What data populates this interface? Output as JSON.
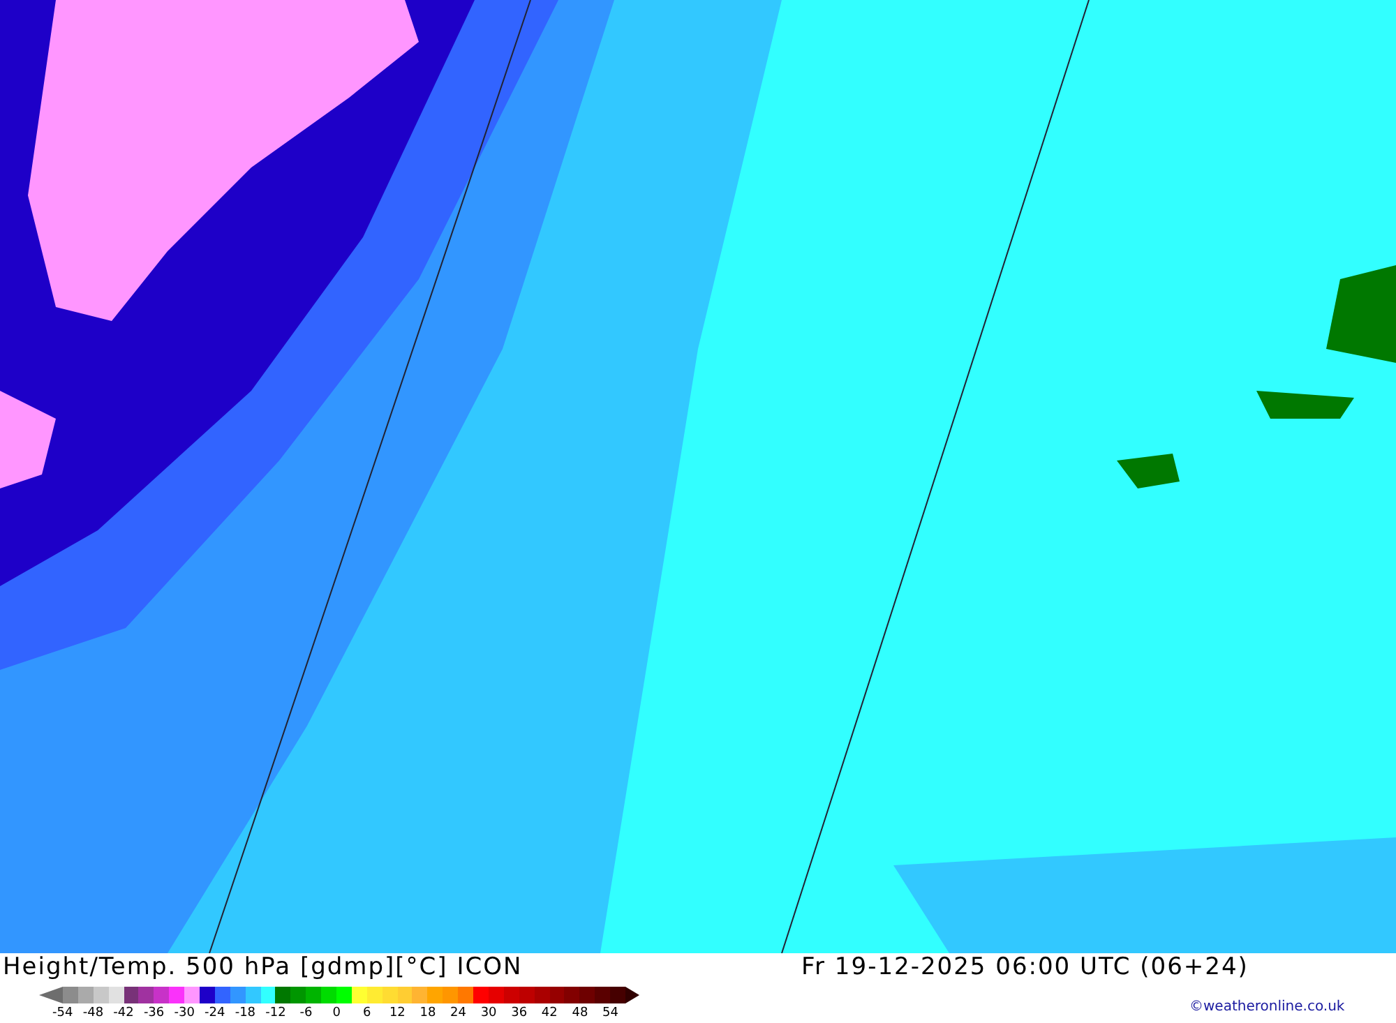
{
  "title": "Height/Temp. 500 hPa [gdmp][°C] ICON",
  "valid_time": "Fr 19-12-2025 06:00 UTC (06+24)",
  "copyright": "©weatheronline.co.uk",
  "legend": {
    "swatches": [
      {
        "color": "#8c8c8c"
      },
      {
        "color": "#aaaaaa"
      },
      {
        "color": "#c8c8c8"
      },
      {
        "color": "#e1e1e1"
      },
      {
        "color": "#783278"
      },
      {
        "color": "#a032a0"
      },
      {
        "color": "#c832c8"
      },
      {
        "color": "#fa32fa"
      },
      {
        "color": "#ff96ff"
      },
      {
        "color": "#1e00c8"
      },
      {
        "color": "#3264ff"
      },
      {
        "color": "#3296ff"
      },
      {
        "color": "#32c8ff"
      },
      {
        "color": "#32ffff"
      },
      {
        "color": "#007800"
      },
      {
        "color": "#009600"
      },
      {
        "color": "#00b400"
      },
      {
        "color": "#00dc00"
      },
      {
        "color": "#00ff00"
      },
      {
        "color": "#ffff32"
      },
      {
        "color": "#ffeb32"
      },
      {
        "color": "#ffdc32"
      },
      {
        "color": "#ffcd32"
      },
      {
        "color": "#ffb432"
      },
      {
        "color": "#ffa500"
      },
      {
        "color": "#ff9600"
      },
      {
        "color": "#ff7800"
      },
      {
        "color": "#ff0000"
      },
      {
        "color": "#e60000"
      },
      {
        "color": "#cd0000"
      },
      {
        "color": "#be0000"
      },
      {
        "color": "#aa0000"
      },
      {
        "color": "#960000"
      },
      {
        "color": "#820000"
      },
      {
        "color": "#6e0000"
      },
      {
        "color": "#5a0000"
      },
      {
        "color": "#460000"
      }
    ],
    "ticks": [
      "-54",
      "-48",
      "-42",
      "-36",
      "-30",
      "-24",
      "-18",
      "-12",
      "-6",
      "0",
      "6",
      "12",
      "18",
      "24",
      "30",
      "36",
      "42",
      "48",
      "54"
    ]
  }
}
